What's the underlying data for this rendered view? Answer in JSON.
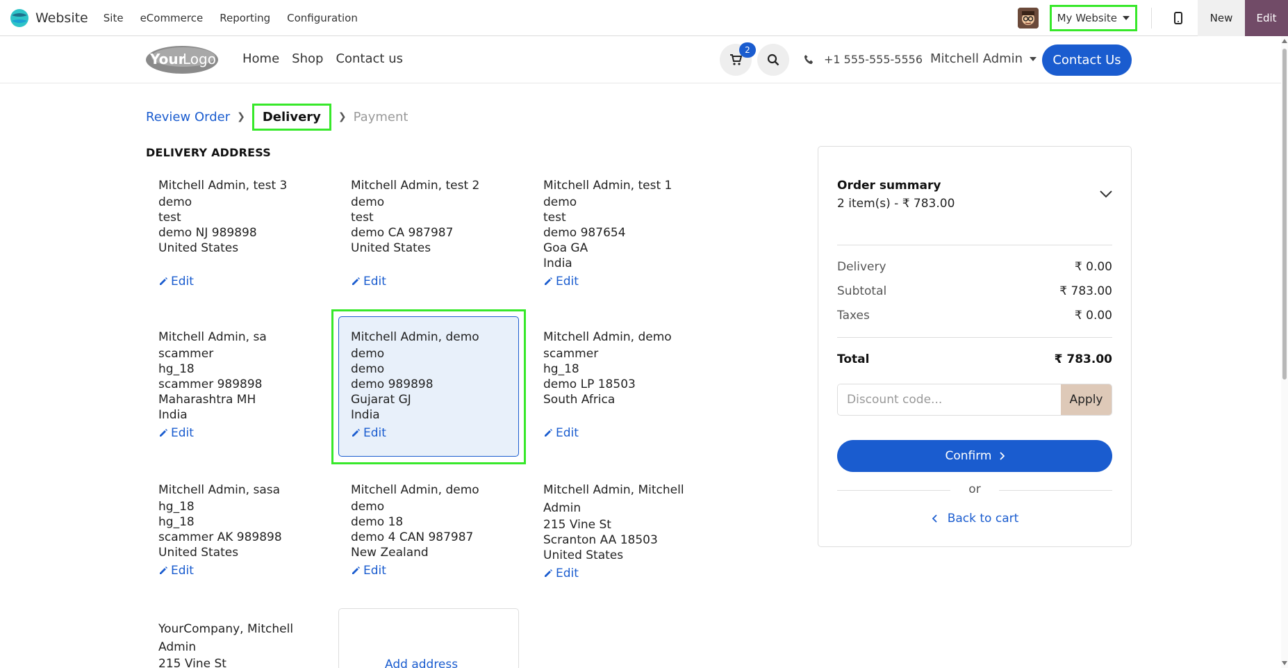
{
  "adminbar": {
    "app_name": "Website",
    "menu": [
      "Site",
      "eCommerce",
      "Reporting",
      "Configuration"
    ],
    "website_select": "My Website",
    "new_label": "New",
    "edit_label": "Edit"
  },
  "header": {
    "nav": [
      "Home",
      "Shop",
      "Contact us"
    ],
    "cart_count": "2",
    "phone": "+1 555-555-5556",
    "user": "Mitchell Admin",
    "contact_btn": "Contact Us"
  },
  "steps": {
    "review": "Review Order",
    "delivery": "Delivery",
    "payment": "Payment"
  },
  "section_title": "DELIVERY ADDRESS",
  "edit_label": "Edit",
  "addresses": [
    {
      "name": "Mitchell Admin, test 3",
      "lines": [
        "demo",
        "test",
        "demo NJ 989898",
        "United States"
      ]
    },
    {
      "name": "Mitchell Admin, test 2",
      "lines": [
        "demo",
        "test",
        "demo CA 987987",
        "United States"
      ]
    },
    {
      "name": "Mitchell Admin, test 1",
      "lines": [
        "demo",
        "test",
        "demo 987654",
        "Goa GA",
        "India"
      ]
    },
    {
      "name": "Mitchell Admin, sa",
      "lines": [
        "scammer",
        "hg_18",
        "scammer 989898",
        "Maharashtra MH",
        "India"
      ]
    },
    {
      "name": "Mitchell Admin, demo",
      "lines": [
        "demo",
        "demo",
        "demo 989898",
        "Gujarat GJ",
        "India"
      ]
    },
    {
      "name": "Mitchell Admin, demo",
      "lines": [
        "scammer",
        "hg_18",
        "demo LP 18503",
        "South Africa"
      ]
    },
    {
      "name": "Mitchell Admin, sasa",
      "lines": [
        "hg_18",
        "hg_18",
        "scammer AK 989898",
        "United States"
      ]
    },
    {
      "name": "Mitchell Admin, demo",
      "lines": [
        "demo",
        "demo 18",
        "demo 4 CAN 987987",
        "New Zealand"
      ]
    },
    {
      "name": "Mitchell Admin, Mitchell",
      "name2": "Admin",
      "lines": [
        "215 Vine St",
        "Scranton AA 18503",
        "United States"
      ]
    },
    {
      "name": "YourCompany, Mitchell",
      "name2": "Admin",
      "lines": [
        "215 Vine St"
      ]
    }
  ],
  "add_address_label": "Add address",
  "summary": {
    "title": "Order summary",
    "items": "2 item(s) -  ₹ 783.00",
    "delivery_label": "Delivery",
    "delivery_value": "₹ 0.00",
    "subtotal_label": "Subtotal",
    "subtotal_value": "₹ 783.00",
    "taxes_label": "Taxes",
    "taxes_value": "₹ 0.00",
    "total_label": "Total",
    "total_value": "₹ 783.00",
    "discount_placeholder": "Discount code...",
    "apply": "Apply",
    "confirm": "Confirm",
    "or": "or",
    "back": "Back to cart"
  }
}
